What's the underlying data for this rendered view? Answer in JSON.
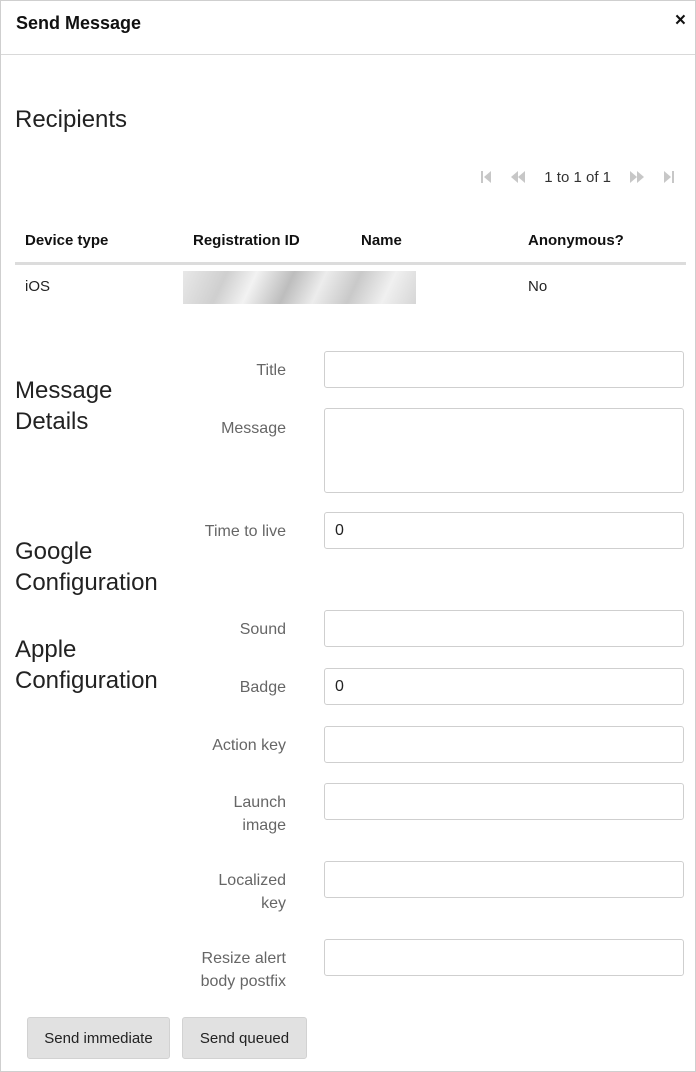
{
  "dialog": {
    "title": "Send Message",
    "close_symbol": "×"
  },
  "recipients": {
    "heading": "Recipients",
    "pager": {
      "text": "1 to 1 of 1",
      "icons": [
        "first-page-icon",
        "previous-page-icon",
        "next-page-icon",
        "last-page-icon"
      ]
    },
    "columns": [
      "Device type",
      "Registration ID",
      "Name",
      "Anonymous?"
    ],
    "rows": [
      {
        "device_type": "iOS",
        "registration_id": "",
        "name": "",
        "anonymous": "No"
      }
    ]
  },
  "message_details": {
    "heading_line1": "Message",
    "heading_line2": "Details",
    "title_label": "Title",
    "title_value": "",
    "message_label": "Message",
    "message_value": ""
  },
  "google_configuration": {
    "heading_line1": "Google",
    "heading_line2": "Configuration",
    "ttl_label": "Time to live",
    "ttl_value": "0"
  },
  "apple_configuration": {
    "heading_line1": "Apple",
    "heading_line2": "Configuration",
    "sound_label": "Sound",
    "sound_value": "",
    "badge_label": "Badge",
    "badge_value": "0",
    "action_key_label": "Action key",
    "action_key_value": "",
    "launch_image_label_line1": "Launch",
    "launch_image_label_line2": "image",
    "launch_image_value": "",
    "localized_key_label_line1": "Localized",
    "localized_key_label_line2": "key",
    "localized_key_value": "",
    "resize_alert_label_line1": "Resize alert",
    "resize_alert_label_line2": "body postfix",
    "resize_alert_value": ""
  },
  "actions": {
    "send_immediate": "Send immediate",
    "send_queued": "Send queued"
  },
  "colors": {
    "pager_icon": "#c7c7c7",
    "button_bg": "#e1e1e1",
    "label_text": "#666666"
  }
}
